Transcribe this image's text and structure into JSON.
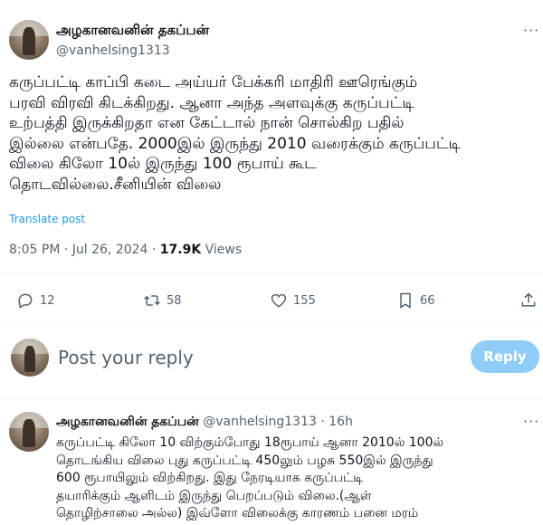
{
  "post": {
    "author_name": "அழகானவனின் தகப்பன்",
    "author_handle": "@vanhelsing1313",
    "more": "···",
    "text": "கருப்பட்டி காப்பி கடை அய்யர் பேக்கரி மாதிரி ஊரெங்கும்\nபரவி விரவி கிடக்கிறது. ஆனா அந்த அளவுக்கு கருப்பட்டி\nஉற்பத்தி இருக்கிறதா என கேட்டால் நான் சொல்கிற பதில்\nஇல்லை என்பதே. 2000இல் இருந்து 2010 வரைக்கும் கருப்பட்டி\nவிலை கிலோ 10ல் இருந்து 100 ரூபாய் கூட\nதொடவில்லை.சீனியின் விலை",
    "translate_label": "Translate post",
    "time": "8:05 PM · Jul 26, 2024 · ",
    "views_count": "17.9K",
    "views_label": " Views"
  },
  "actions": {
    "replies": "12",
    "reposts": "58",
    "likes": "155",
    "bookmarks": "66"
  },
  "composer": {
    "placeholder": "Post your reply",
    "button": "Reply"
  },
  "reply": {
    "author_name": "அழகானவனின் தகப்பன்",
    "meta": "@vanhelsing1313 · 16h",
    "more": "···",
    "text": "கருப்பட்டி கிலோ 10 விற்கும்போது 18ரூபாய் ஆனா 2010ல் 100ல்\nதொடங்கிய விலை புது கருப்பட்டி 450லும் பழசு 550இல் இருந்து\n600 ரூபாயிலும் விற்கிறது. இது நேரடியாக கருப்பட்டி\nதயாரிக்கும் ஆளிடம் இருந்து பெறப்படும் விலை.(ஆள்\nதொழிற்சாலை அல்ல) இவ்ளோ விலைக்கு காரணம் பனை மரம்"
  },
  "colors": {
    "accent": "#1d9bf0",
    "reply_button": "#8ecdf8",
    "muted": "#536471"
  }
}
